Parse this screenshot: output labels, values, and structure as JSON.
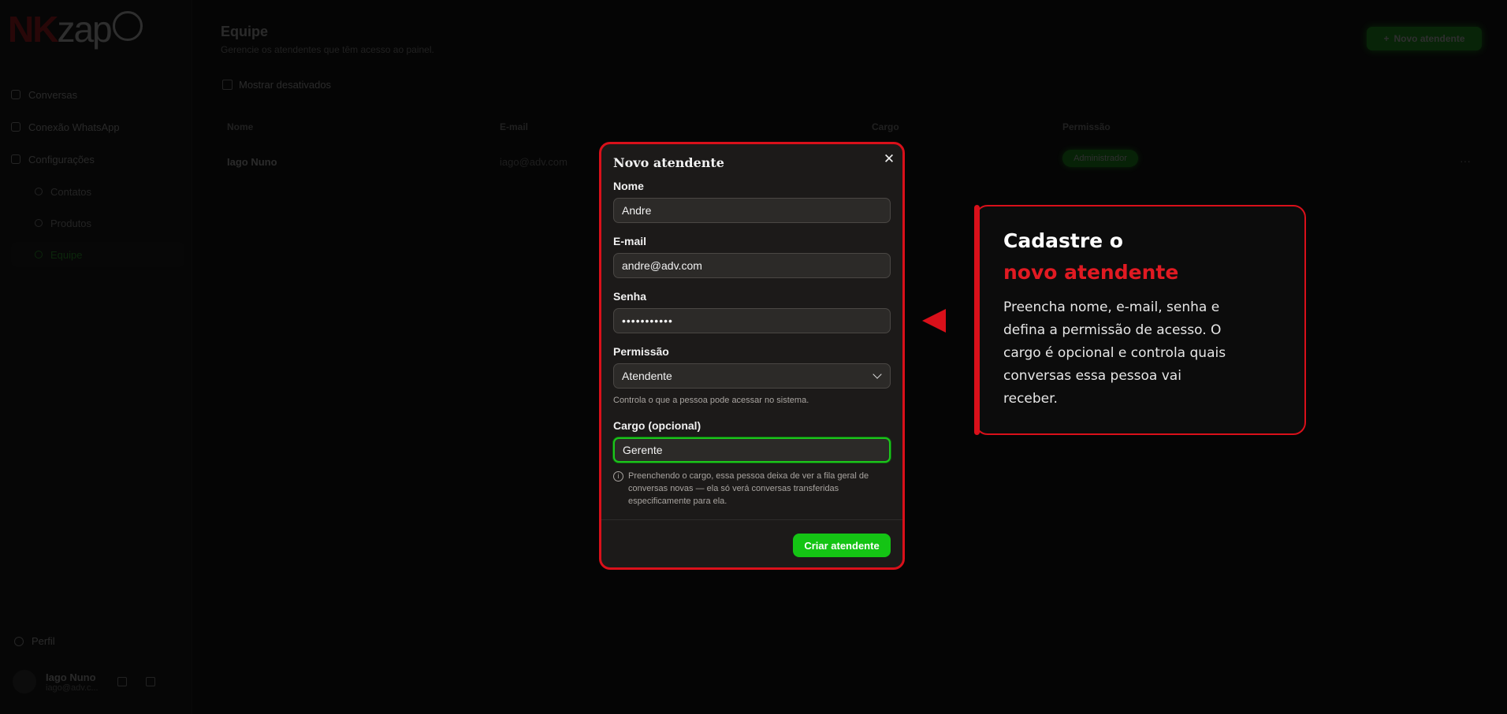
{
  "background": {
    "logo": {
      "part1": "NK",
      "part2": "zap"
    },
    "nav": [
      {
        "label": "Conversas",
        "icon": "chat-icon"
      },
      {
        "label": "Conexão WhatsApp",
        "icon": "plug-icon"
      },
      {
        "label": "Configurações",
        "icon": "gear-icon"
      }
    ],
    "subnav": [
      {
        "label": "Contatos"
      },
      {
        "label": "Produtos"
      },
      {
        "label": "Equipe"
      }
    ],
    "profile_label": "Perfil",
    "user": {
      "name": "Iago Nuno",
      "email": "iago@adv.c..."
    },
    "page_title": "Equipe",
    "page_subtitle": "Gerencie os atendentes que têm acesso ao painel.",
    "show_inactive_label": "Mostrar desativados",
    "new_button_label": "Novo atendente",
    "table": {
      "headers": [
        "Nome",
        "E-mail",
        "Cargo",
        "Permissão"
      ],
      "row": {
        "name": "Iago Nuno",
        "email": "iago@adv.com",
        "permission": "Administrador",
        "menu": "···"
      }
    }
  },
  "modal": {
    "title": "Novo atendente",
    "close_symbol": "✕",
    "fields": {
      "name": {
        "label": "Nome",
        "value": "Andre"
      },
      "email": {
        "label": "E-mail",
        "value": "andre@adv.com"
      },
      "password": {
        "label": "Senha",
        "value": "•••••••••••"
      },
      "permission": {
        "label": "Permissão",
        "value": "Atendente",
        "hint": "Controla o que a pessoa pode acessar no sistema."
      },
      "role": {
        "label": "Cargo (opcional)",
        "value": "Gerente",
        "info": "Preenchendo o cargo, essa pessoa deixa de ver a fila geral de conversas novas — ela só verá conversas transferidas especificamente para ela."
      }
    },
    "submit_label": "Criar atendente"
  },
  "callout": {
    "title_line1": "Cadastre o",
    "title_line2": "novo atendente",
    "body": "Preencha nome, e-mail, senha e defina a permissão de acesso. O cargo é opcional e controla quais conversas essa pessoa vai receber."
  },
  "colors": {
    "accent_red": "#d9101a",
    "accent_green": "#14c414",
    "modal_bg": "#1c1a19",
    "page_bg": "#050505"
  }
}
